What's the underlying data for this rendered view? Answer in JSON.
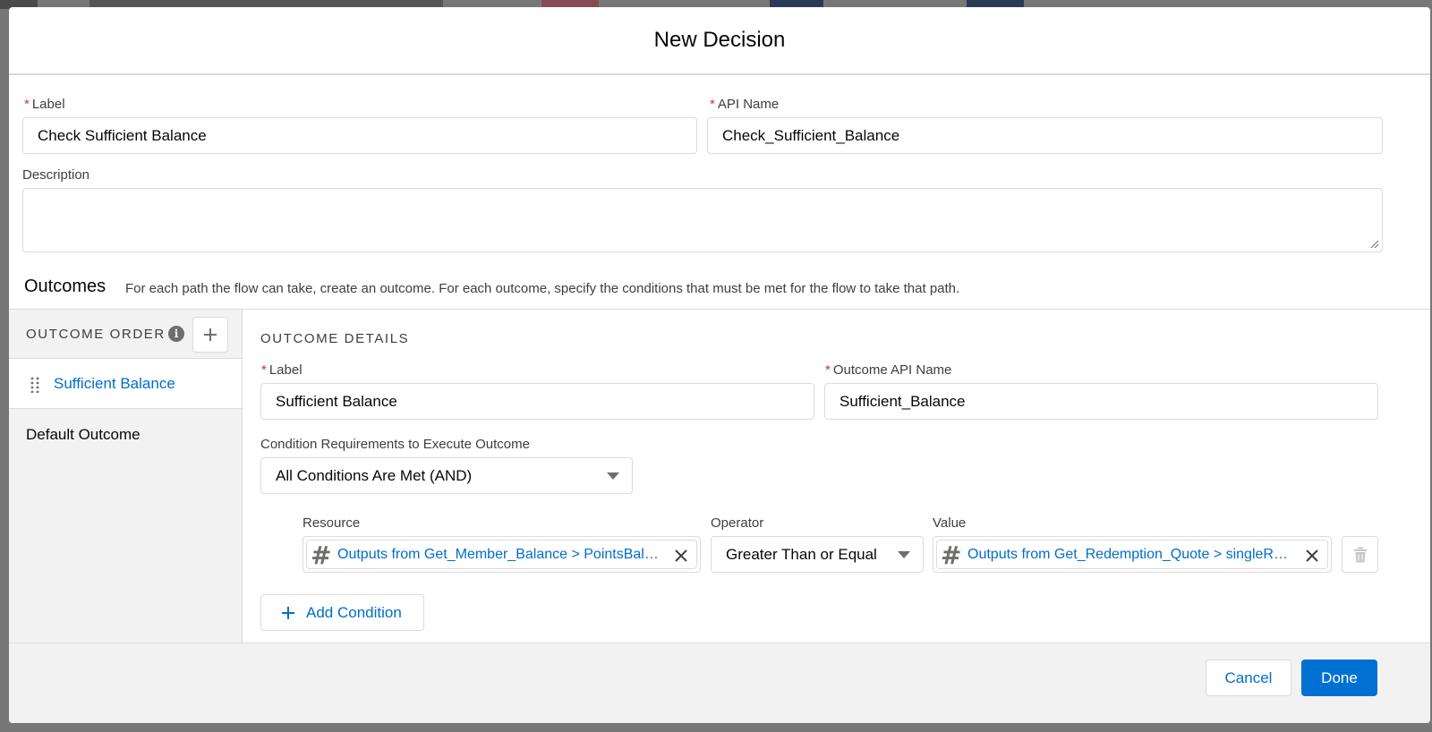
{
  "modal": {
    "title": "New Decision"
  },
  "form": {
    "label": {
      "text": "Label",
      "value": "Check Sufficient Balance"
    },
    "api_name": {
      "text": "API Name",
      "value": "Check_Sufficient_Balance"
    },
    "description": {
      "text": "Description",
      "value": ""
    }
  },
  "outcomes": {
    "title": "Outcomes",
    "help": "For each path the flow can take, create an outcome. For each outcome, specify the conditions that must be met for the flow to take that path.",
    "order_title": "OUTCOME ORDER",
    "items": [
      {
        "label": "Sufficient Balance",
        "active": true
      },
      {
        "label": "Default Outcome",
        "active": false
      }
    ]
  },
  "details": {
    "title": "OUTCOME DETAILS",
    "label": {
      "text": "Label",
      "value": "Sufficient Balance"
    },
    "api_name": {
      "text": "Outcome API Name",
      "value": "Sufficient_Balance"
    },
    "condition_req": {
      "text": "Condition Requirements to Execute Outcome",
      "value": "All Conditions Are Met (AND)"
    },
    "condition": {
      "resource_label": "Resource",
      "operator_label": "Operator",
      "value_label": "Value",
      "resource": "Outputs from Get_Member_Balance > PointsBalance",
      "operator": "Greater Than or Equal",
      "value": "Outputs from Get_Redemption_Quote > singleRedemption"
    },
    "add_condition": "Add Condition"
  },
  "footer": {
    "cancel": "Cancel",
    "done": "Done"
  },
  "colors": {
    "brand": "#0070d2",
    "link": "#006dcc",
    "required": "#c23934",
    "border": "#dddbda",
    "pane": "#f3f2f2"
  },
  "icons": [
    "info-icon",
    "add-icon",
    "drag-handle-icon",
    "chevron-down-icon",
    "number-icon",
    "close-icon",
    "trash-icon",
    "add-icon"
  ]
}
